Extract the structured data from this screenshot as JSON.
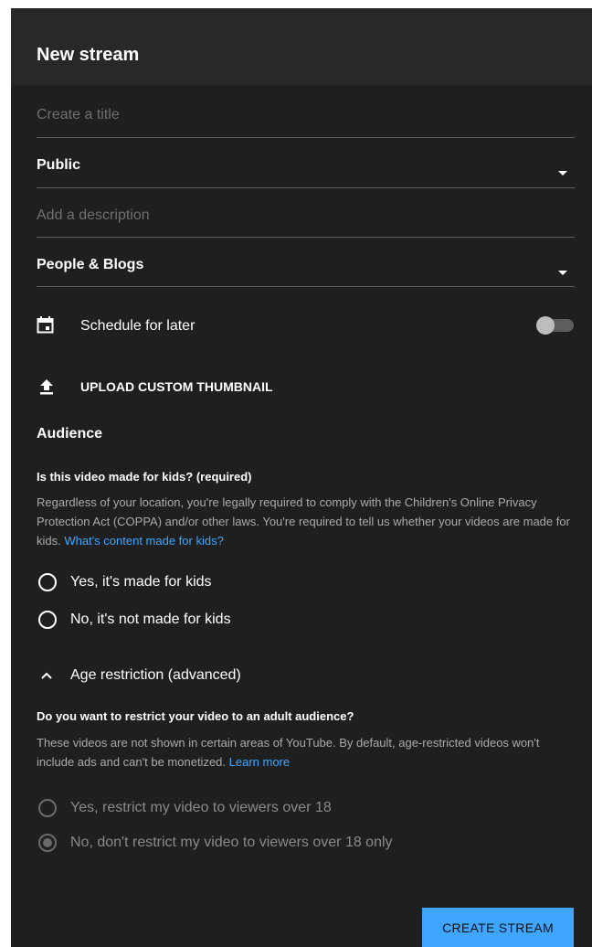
{
  "header": {
    "title": "New stream"
  },
  "form": {
    "title_placeholder": "Create a title",
    "visibility": "Public",
    "description_placeholder": "Add a description",
    "category": "People & Blogs"
  },
  "schedule": {
    "label": "Schedule for later",
    "enabled": false
  },
  "thumbnail": {
    "label": "UPLOAD CUSTOM THUMBNAIL"
  },
  "audience": {
    "heading": "Audience",
    "question": "Is this video made for kids? (required)",
    "body": "Regardless of your location, you're legally required to comply with the Children's Online Privacy Protection Act (COPPA) and/or other laws. You're required to tell us whether your videos are made for kids.",
    "link": "What's content made for kids?",
    "options": [
      "Yes, it's made for kids",
      "No, it's not made for kids"
    ]
  },
  "age_restriction": {
    "toggle_label": "Age restriction (advanced)",
    "question": "Do you want to restrict your video to an adult audience?",
    "body": "These videos are not shown in certain areas of YouTube. By default, age-restricted videos won't include ads and can't be monetized.",
    "link": "Learn more",
    "options": [
      "Yes, restrict my video to viewers over 18",
      "No, don't restrict my video to viewers over 18 only"
    ],
    "selected_index": 1
  },
  "actions": {
    "create_label": "CREATE STREAM"
  },
  "colors": {
    "accent": "#3ea6ff",
    "background": "#1f1f1f",
    "header": "#282828"
  }
}
